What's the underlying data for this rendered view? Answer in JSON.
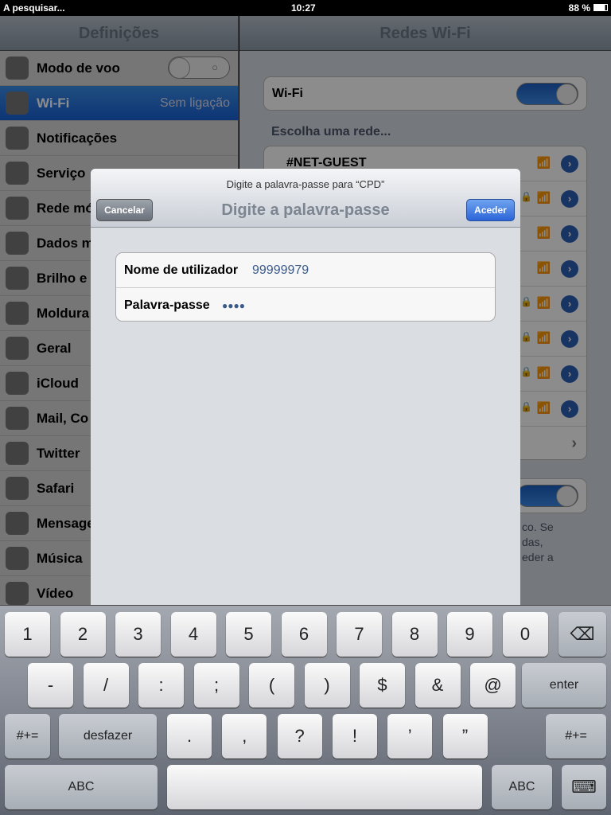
{
  "status": {
    "left": "A pesquisar...",
    "time": "10:27",
    "battery": "88 %"
  },
  "sidebar": {
    "title": "Definições",
    "items": [
      {
        "label": "Modo de voo",
        "icon": "airplane-icon",
        "toggle": "off"
      },
      {
        "label": "Wi-Fi",
        "icon": "wifi-icon",
        "value": "Sem ligação",
        "selected": true
      },
      {
        "label": "Notificações",
        "icon": "notifications-icon"
      },
      {
        "label": "Serviço",
        "icon": "location-icon"
      },
      {
        "label": "Rede mó",
        "icon": "phone-icon"
      },
      {
        "label": "Dados m",
        "icon": "antenna-icon"
      },
      {
        "label": "Brilho e",
        "icon": "flower-icon"
      },
      {
        "label": "Moldura",
        "icon": "frame-icon"
      },
      {
        "label": "Geral",
        "icon": "gear-icon"
      },
      {
        "label": "iCloud",
        "icon": "cloud-icon"
      },
      {
        "label": "Mail, Co",
        "icon": "mail-icon"
      },
      {
        "label": "Twitter",
        "icon": "twitter-icon"
      },
      {
        "label": "Safari",
        "icon": "compass-icon"
      },
      {
        "label": "Mensage",
        "icon": "messages-icon"
      },
      {
        "label": "Música",
        "icon": "music-icon"
      },
      {
        "label": "Vídeo",
        "icon": "video-icon"
      }
    ]
  },
  "main": {
    "title": "Redes Wi-Fi",
    "wifi_label": "Wi-Fi",
    "wifi_on": true,
    "choose": "Escolha uma rede...",
    "networks": [
      {
        "name": "#NET-GUEST",
        "locked": false
      }
    ],
    "ask_text": [
      "co. Se",
      "das,",
      "eder a"
    ]
  },
  "modal": {
    "prompt": "Digite a palavra-passe para “CPD”",
    "title": "Digite a palavra-passe",
    "cancel": "Cancelar",
    "ok": "Aceder",
    "user_label": "Nome de utilizador",
    "user_value": "99999979",
    "pass_label": "Palavra-passe",
    "pass_value": "●●●●"
  },
  "keyboard": {
    "row1": [
      "1",
      "2",
      "3",
      "4",
      "5",
      "6",
      "7",
      "8",
      "9",
      "0"
    ],
    "row2": [
      "-",
      "/",
      ":",
      ";",
      "(",
      ")",
      "$",
      "&",
      "@"
    ],
    "enter": "enter",
    "row3": [
      ".",
      ",",
      "?",
      "!",
      "’",
      "”"
    ],
    "sym": "#+=",
    "undo": "desfazer",
    "abc": "ABC"
  }
}
